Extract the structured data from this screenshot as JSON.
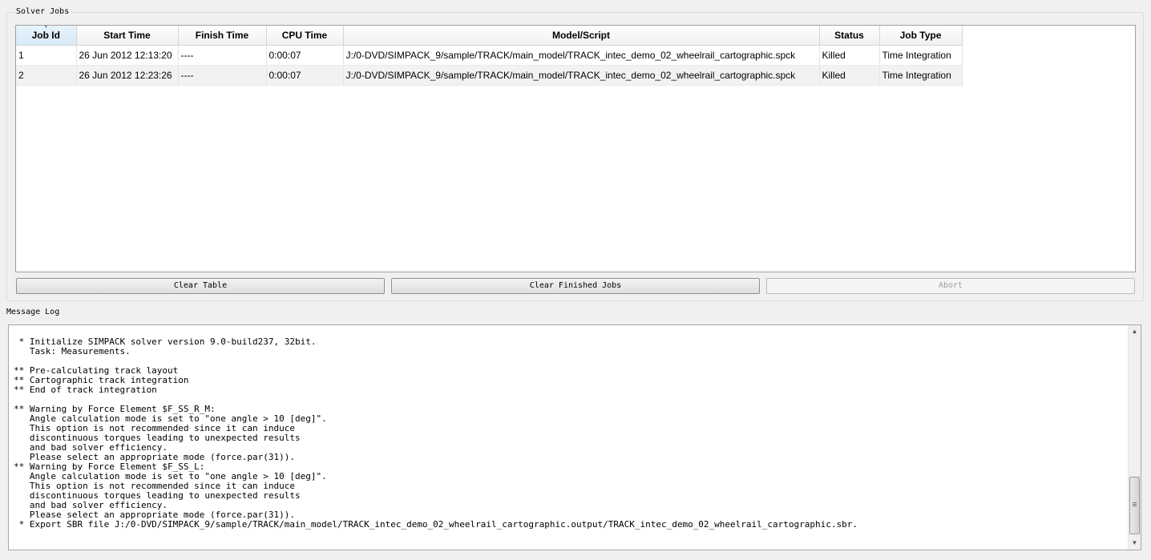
{
  "solver_jobs": {
    "title": "Solver Jobs",
    "columns": [
      "Job Id",
      "Start Time",
      "Finish Time",
      "CPU Time",
      "Model/Script",
      "Status",
      "Job Type"
    ],
    "rows": [
      [
        "1",
        "26 Jun 2012 12:13:20",
        "----",
        "0:00:07",
        "J:/0-DVD/SIMPACK_9/sample/TRACK/main_model/TRACK_intec_demo_02_wheelrail_cartographic.spck",
        "Killed",
        "Time Integration"
      ],
      [
        "2",
        "26 Jun 2012 12:23:26",
        "----",
        "0:00:07",
        "J:/0-DVD/SIMPACK_9/sample/TRACK/main_model/TRACK_intec_demo_02_wheelrail_cartographic.spck",
        "Killed",
        "Time Integration"
      ]
    ],
    "buttons": {
      "clear_table": "Clear Table",
      "clear_finished": "Clear Finished Jobs",
      "abort": "Abort"
    }
  },
  "message_log": {
    "title": "Message Log",
    "text": " * Initialize SIMPACK solver version 9.0-build237, 32bit.\n   Task: Measurements.\n\n** Pre-calculating track layout\n** Cartographic track integration\n** End of track integration\n\n** Warning by Force Element $F_SS_R_M:\n   Angle calculation mode is set to \"one angle > 10 [deg]\".\n   This option is not recommended since it can induce\n   discontinuous torques leading to unexpected results\n   and bad solver efficiency.\n   Please select an appropriate mode (force.par(31)).\n** Warning by Force Element $F_SS_L:\n   Angle calculation mode is set to \"one angle > 10 [deg]\".\n   This option is not recommended since it can induce\n   discontinuous torques leading to unexpected results\n   and bad solver efficiency.\n   Please select an appropriate mode (force.par(31)).\n * Export SBR file J:/0-DVD/SIMPACK_9/sample/TRACK/main_model/TRACK_intec_demo_02_wheelrail_cartographic.output/TRACK_intec_demo_02_wheelrail_cartographic.sbr."
  },
  "icons": {
    "sort": "sort-indicator-icon",
    "scroll_up": "scroll-up-arrow-icon",
    "scroll_down": "scroll-down-arrow-icon"
  }
}
